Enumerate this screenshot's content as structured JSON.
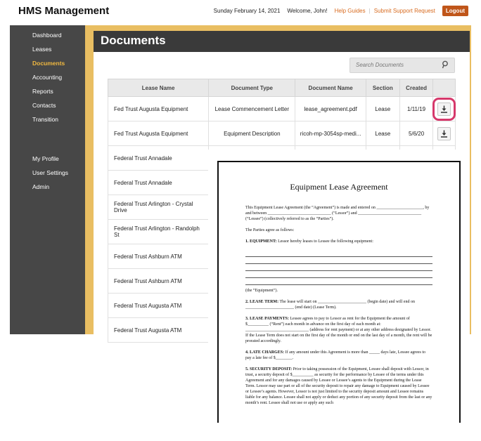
{
  "app": {
    "title": "HMS Management"
  },
  "topbar": {
    "date": "Sunday February 14, 2021",
    "welcome": "Welcome, John!",
    "help": "Help Guides",
    "separator": "|",
    "support": "Submit Support Request",
    "logout": "Logout"
  },
  "sidebar": {
    "items": [
      {
        "label": "Dashboard"
      },
      {
        "label": "Leases"
      },
      {
        "label": "Documents"
      },
      {
        "label": "Accounting"
      },
      {
        "label": "Reports"
      },
      {
        "label": "Contacts"
      },
      {
        "label": "Transition"
      }
    ],
    "secondary": [
      {
        "label": "My Profile"
      },
      {
        "label": "User Settings"
      },
      {
        "label": "Admin"
      }
    ]
  },
  "main": {
    "title": "Documents",
    "search_placeholder": "Search Documents"
  },
  "table": {
    "headers": [
      "Lease Name",
      "Document Type",
      "Document Name",
      "Section",
      "Created"
    ],
    "rows": [
      {
        "lease": "Fed Trust Augusta Equipment",
        "type": "Lease Commencement Letter",
        "doc": "lease_agreement.pdf",
        "section": "Lease",
        "created": "1/11/19"
      },
      {
        "lease": "Fed Trust Augusta Equipment",
        "type": "Equipment Description",
        "doc": "ricoh-mp-3054sp-medi...",
        "section": "Lease",
        "created": "5/6/20"
      },
      {
        "lease": "Federal Trust Annadale"
      },
      {
        "lease": "Federal Trust Annadale"
      },
      {
        "lease": "Federal Trust Arlington - Crystal Drive"
      },
      {
        "lease": "Federal Trust Arlington - Randolph St"
      },
      {
        "lease": "Federal Trust Ashburn ATM"
      },
      {
        "lease": "Federal Trust Ashburn ATM"
      },
      {
        "lease": "Federal Trust Augusta ATM"
      },
      {
        "lease": "Federal Trust Augusta ATM"
      }
    ]
  },
  "document_preview": {
    "title": "Equipment Lease Agreement",
    "intro": "This Equipment Lease Agreement (the “Agreement”) is made and entered on ______________________, by and between ______________________________ (“Lessor”) and ______________________________ (“Lessee”) (collectively referred to as the “Parties”).",
    "parties": "The Parties agree as follows:",
    "s1_head": "1. EQUIPMENT:",
    "s1_text": "Lessor hereby leases to Lessee the following equipment:",
    "s1_tail": "(the “Equipment”).",
    "s2_head": "2. LEASE TERM:",
    "s2_text": "The lease will start on _______________________ (begin date) and will end on _______________________ (end date) (Lease Term).",
    "s3_head": "3. LEASE PAYMENTS:",
    "s3_text": "Lessee agrees to pay to Lessor as rent for the Equipment the amount of $__________ (“Rent”) each month in advance on the first day of each month at: ______________________________ (address for rent payment) or at any other address designated by Lessor. If the Lease Term does not start on the first day of the month or end on the last day of a month, the rent will be prorated accordingly.",
    "s4_head": "4. LATE CHARGES:",
    "s4_text": "If any amount under this Agreement is more than _____ days late, Lessee agrees to pay a late fee of $________.",
    "s5_head": "5. SECURITY DEPOSIT:",
    "s5_text": "Prior to taking possession of the Equipment, Lessee shall deposit with Lessor, in trust, a security deposit of $__________ as security for the performance by Lessee of the terms under this Agreement and for any damages caused by Lessee or Lessee’s agents to the Equipment during the Lease Term. Lessor may use part or all of the security deposit to repair any damage to Equipment caused by Lessee or Lessee’s agents. However, Lessor is not just limited to the security deposit amount and Lessee remains liable for any balance. Lessee shall not apply or deduct any portion of any security deposit from the last or any month’s rent. Lessee shall not use or apply any such"
  },
  "icons": {
    "search": "search-icon",
    "download": "download-icon"
  },
  "colors": {
    "accent": "#d86b1f",
    "active_nav": "#f0b840",
    "highlight": "#d6386b",
    "frame": "#e9be62"
  }
}
